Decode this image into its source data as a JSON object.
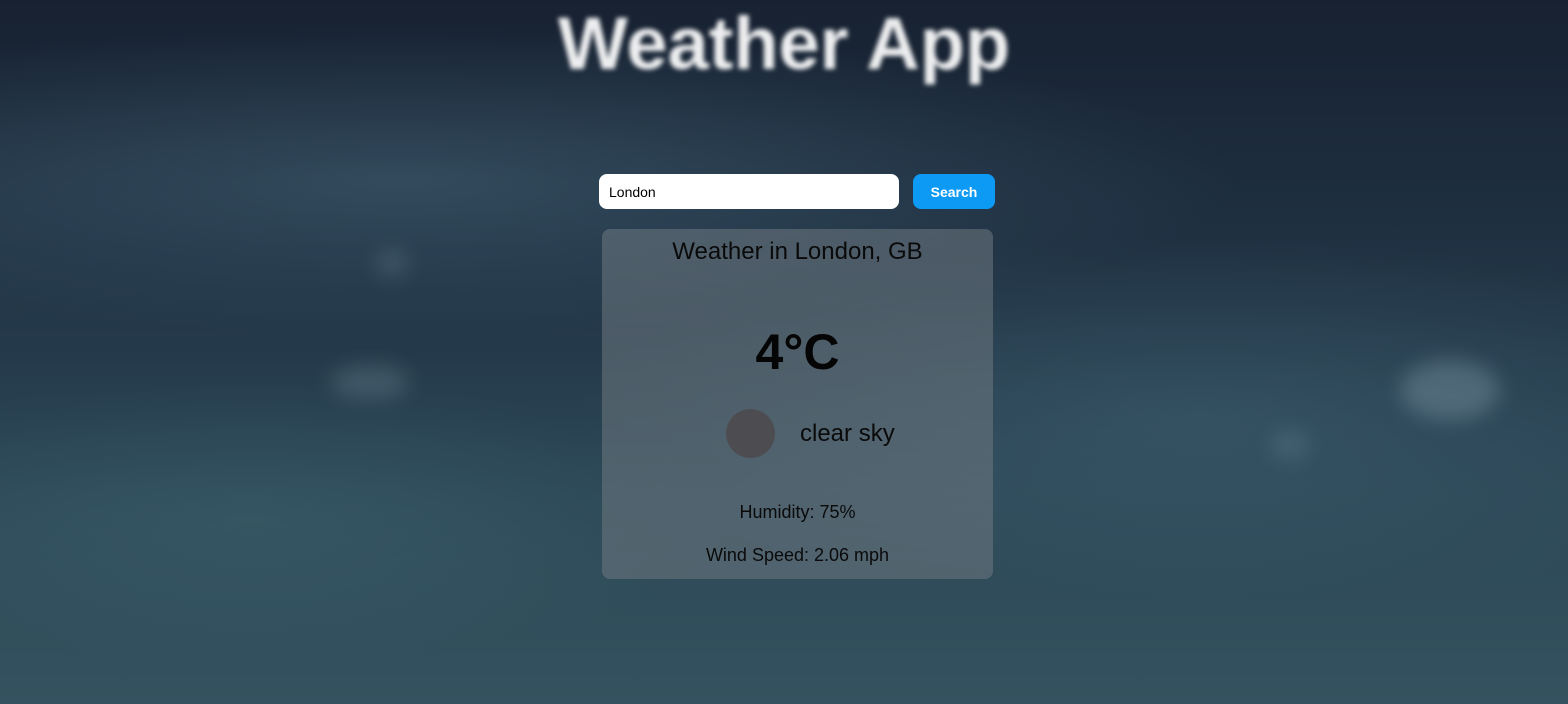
{
  "app": {
    "title": "Weather App"
  },
  "search": {
    "value": "London",
    "placeholder": "",
    "button_label": "Search"
  },
  "weather": {
    "title_prefix": "Weather in",
    "city": "London, GB",
    "title": "Weather in London, GB",
    "temperature": "4°C",
    "icon": "weather-icon",
    "description": "clear sky",
    "humidity": "Humidity: 75%",
    "wind_speed": "Wind Speed: 2.06 mph"
  },
  "colors": {
    "search_button": "#0c9af5",
    "card_background": "rgba(110,120,128,0.55)",
    "icon_placeholder": "#4d4d51"
  }
}
